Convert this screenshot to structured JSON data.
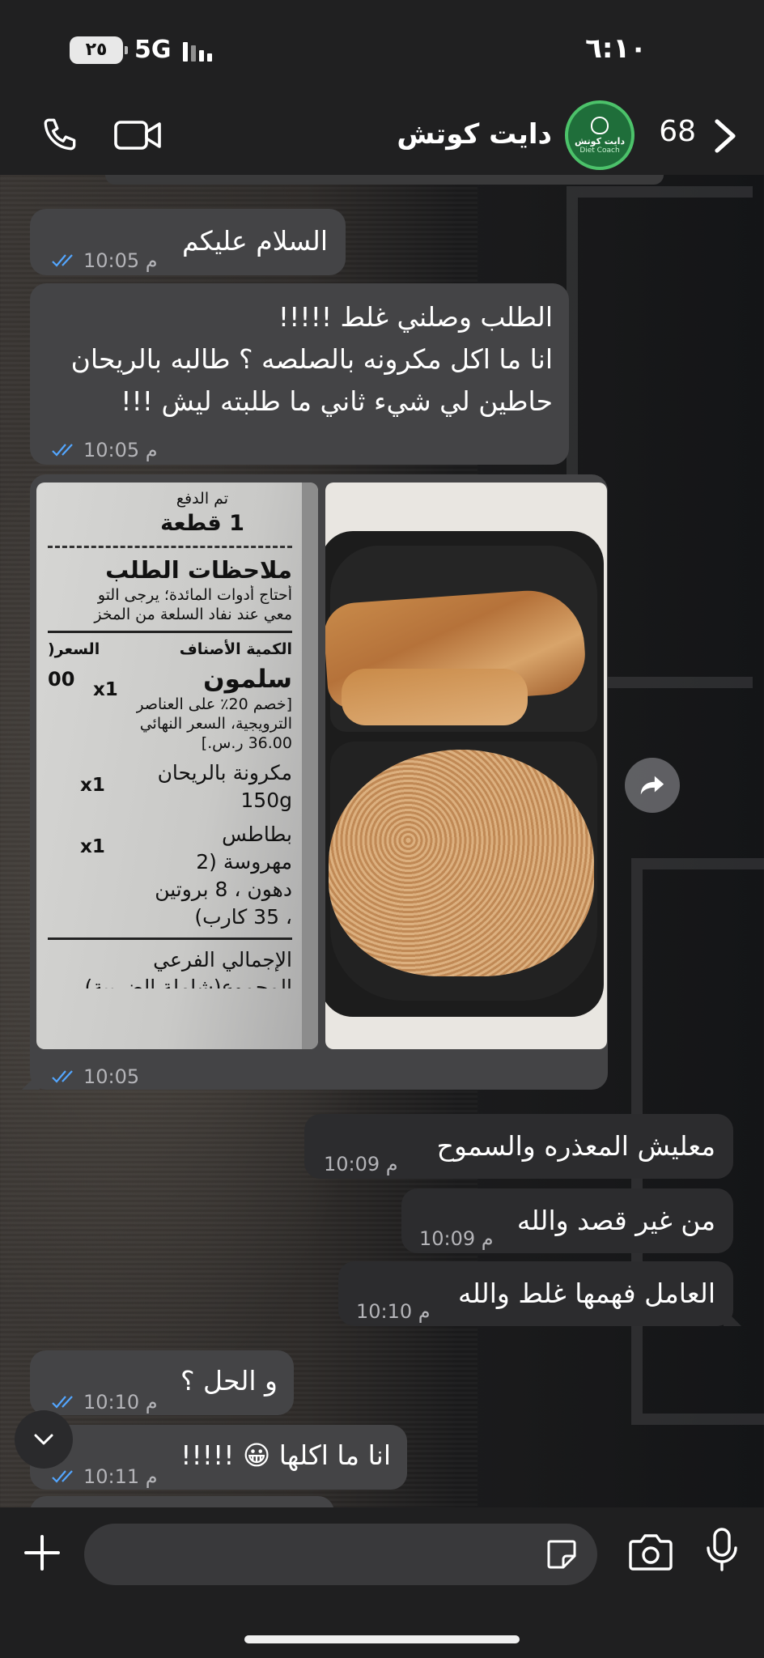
{
  "status_bar": {
    "time": "٦:١٠",
    "battery": "٢٥",
    "network": "5G"
  },
  "header": {
    "contact_name": "دايت كوتش",
    "avatar_text": "دايت كوتش",
    "avatar_sub": "Diet Coach",
    "unread_count": "68"
  },
  "messages": [
    {
      "direction": "in",
      "text": "السلام عليكم",
      "time": "10:05 م"
    },
    {
      "direction": "in",
      "lines": [
        "الطلب وصلني غلط !!!!!",
        "انا ما اكل مكرونه بالصلصه ؟ طالبه بالريحان",
        "حاطين لي شيء ثاني ما طلبته ليش !!!"
      ],
      "time": "10:05 م"
    },
    {
      "direction": "in",
      "type": "album",
      "time": "10:05"
    },
    {
      "direction": "out",
      "text": "معليش المعذره والسموح",
      "time": "10:09 م"
    },
    {
      "direction": "out",
      "text": "من غير قصد والله",
      "time": "10:09 م"
    },
    {
      "direction": "out",
      "text": "العامل فهمها غلط والله",
      "time": "10:10 م"
    },
    {
      "direction": "in",
      "text": "و الحل ؟",
      "time": "10:10 م"
    },
    {
      "direction": "in",
      "text": "انا ما اكلها 😀 !!!!!",
      "time": "10:11 م"
    }
  ],
  "receipt": {
    "paid": "تم الدفع",
    "pieces": "1 قطعة",
    "notes_title": "ملاحظات الطلب",
    "notes_line1": "أحتاج أدوات المائدة؛ يرجى التو",
    "notes_line2": "معي عند نفاد السلعة من المخز",
    "col_qty_items": "الكمية الأصناف",
    "col_price": "السعر(",
    "item1_qty": "x1",
    "item1_name": "سلمون",
    "item1_price": "00",
    "item1_note1": "[خصم 20٪ على العناصر",
    "item1_note2": "الترويجية، السعر النهائي",
    "item1_note3": "36.00 ر.س.]",
    "item2_qty": "x1",
    "item2_name": "مكرونة بالريحان",
    "item2_size": "150g",
    "item3_qty": "x1",
    "item3_name1": "بطاطس",
    "item3_name2": "مهروسة (2",
    "item3_name3": "دهون ، 8 بروتين",
    "item3_name4": "، 35 كارب)",
    "subtotal": "الإجمالي الفرعي",
    "total_partial": "المجموع(شاملة الضريبة)"
  },
  "composer": {
    "placeholder": ""
  },
  "colors": {
    "incoming_bubble": "#444446",
    "outgoing_bubble": "#2c2c2e",
    "read_ticks": "#53a6ff",
    "avatar_ring": "#4cc26a"
  },
  "icons": [
    "call-icon",
    "video-icon",
    "back-chevron-icon",
    "share-icon",
    "chevron-down-icon",
    "plus-icon",
    "sticker-icon",
    "camera-icon",
    "mic-icon",
    "read-ticks-icon"
  ]
}
